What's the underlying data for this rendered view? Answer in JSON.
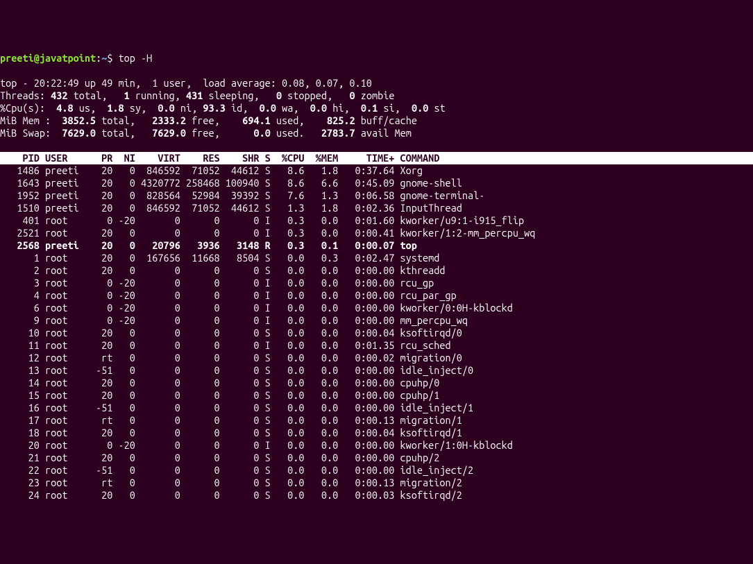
{
  "prompt": {
    "user": "preeti",
    "host": "javatpoint",
    "path": "~",
    "command": "top -H"
  },
  "summary": {
    "line1": "top - 20:22:49 up 49 min,  1 user,  load average: 0.08, 0.07, 0.10",
    "line2_prefix": "Threads: ",
    "line2_total": "432",
    "line2_total_lbl": " total,   ",
    "line2_running": "1",
    "line2_running_lbl": " running, ",
    "line2_sleeping": "431",
    "line2_sleeping_lbl": " sleeping,   ",
    "line2_stopped": "0",
    "line2_stopped_lbl": " stopped,   ",
    "line2_zombie": "0",
    "line2_zombie_lbl": " zombie",
    "line3_prefix": "%Cpu(s):  ",
    "line3_us": "4.8",
    "line3_us_lbl": " us,  ",
    "line3_sy": "1.8",
    "line3_sy_lbl": " sy,  ",
    "line3_ni": "0.0",
    "line3_ni_lbl": " ni, ",
    "line3_id": "93.3",
    "line3_id_lbl": " id,  ",
    "line3_wa": "0.0",
    "line3_wa_lbl": " wa,  ",
    "line3_hi": "0.0",
    "line3_hi_lbl": " hi,  ",
    "line3_si": "0.1",
    "line3_si_lbl": " si,  ",
    "line3_st": "0.0",
    "line3_st_lbl": " st",
    "line4_prefix": "MiB Mem :  ",
    "line4_total": "3852.5",
    "line4_total_lbl": " total,   ",
    "line4_free": "2333.2",
    "line4_free_lbl": " free,    ",
    "line4_used": "694.1",
    "line4_used_lbl": " used,    ",
    "line4_buff": "825.2",
    "line4_buff_lbl": " buff/cache",
    "line5_prefix": "MiB Swap:  ",
    "line5_total": "7629.0",
    "line5_total_lbl": " total,   ",
    "line5_free": "7629.0",
    "line5_free_lbl": " free,      ",
    "line5_used": "0.0",
    "line5_used_lbl": " used.   ",
    "line5_avail": "2783.7",
    "line5_avail_lbl": " avail Mem"
  },
  "header": "    PID USER      PR  NI    VIRT    RES    SHR S  %CPU  %MEM     TIME+ COMMAND                                                          ",
  "processes": [
    {
      "pid": "1486",
      "user": "preeti",
      "pr": "20",
      "ni": "0",
      "virt": "846592",
      "res": "71052",
      "shr": "44612",
      "s": "S",
      "cpu": "8.6",
      "mem": "1.8",
      "time": "0:37.64",
      "cmd": "Xorg",
      "bold": false
    },
    {
      "pid": "1643",
      "user": "preeti",
      "pr": "20",
      "ni": "0",
      "virt": "4320772",
      "res": "258468",
      "shr": "100940",
      "s": "S",
      "cpu": "8.6",
      "mem": "6.6",
      "time": "0:45.09",
      "cmd": "gnome-shell",
      "bold": false
    },
    {
      "pid": "1952",
      "user": "preeti",
      "pr": "20",
      "ni": "0",
      "virt": "828564",
      "res": "52984",
      "shr": "39392",
      "s": "S",
      "cpu": "7.6",
      "mem": "1.3",
      "time": "0:06.58",
      "cmd": "gnome-terminal-",
      "bold": false
    },
    {
      "pid": "1510",
      "user": "preeti",
      "pr": "20",
      "ni": "0",
      "virt": "846592",
      "res": "71052",
      "shr": "44612",
      "s": "S",
      "cpu": "1.3",
      "mem": "1.8",
      "time": "0:02.36",
      "cmd": "InputThread",
      "bold": false
    },
    {
      "pid": "401",
      "user": "root",
      "pr": "0",
      "ni": "-20",
      "virt": "0",
      "res": "0",
      "shr": "0",
      "s": "I",
      "cpu": "0.3",
      "mem": "0.0",
      "time": "0:01.60",
      "cmd": "kworker/u9:1-i915_flip",
      "bold": false
    },
    {
      "pid": "2521",
      "user": "root",
      "pr": "20",
      "ni": "0",
      "virt": "0",
      "res": "0",
      "shr": "0",
      "s": "I",
      "cpu": "0.3",
      "mem": "0.0",
      "time": "0:00.41",
      "cmd": "kworker/1:2-mm_percpu_wq",
      "bold": false
    },
    {
      "pid": "2568",
      "user": "preeti",
      "pr": "20",
      "ni": "0",
      "virt": "20796",
      "res": "3936",
      "shr": "3148",
      "s": "R",
      "cpu": "0.3",
      "mem": "0.1",
      "time": "0:00.07",
      "cmd": "top",
      "bold": true
    },
    {
      "pid": "1",
      "user": "root",
      "pr": "20",
      "ni": "0",
      "virt": "167656",
      "res": "11668",
      "shr": "8504",
      "s": "S",
      "cpu": "0.0",
      "mem": "0.3",
      "time": "0:02.47",
      "cmd": "systemd",
      "bold": false
    },
    {
      "pid": "2",
      "user": "root",
      "pr": "20",
      "ni": "0",
      "virt": "0",
      "res": "0",
      "shr": "0",
      "s": "S",
      "cpu": "0.0",
      "mem": "0.0",
      "time": "0:00.00",
      "cmd": "kthreadd",
      "bold": false
    },
    {
      "pid": "3",
      "user": "root",
      "pr": "0",
      "ni": "-20",
      "virt": "0",
      "res": "0",
      "shr": "0",
      "s": "I",
      "cpu": "0.0",
      "mem": "0.0",
      "time": "0:00.00",
      "cmd": "rcu_gp",
      "bold": false
    },
    {
      "pid": "4",
      "user": "root",
      "pr": "0",
      "ni": "-20",
      "virt": "0",
      "res": "0",
      "shr": "0",
      "s": "I",
      "cpu": "0.0",
      "mem": "0.0",
      "time": "0:00.00",
      "cmd": "rcu_par_gp",
      "bold": false
    },
    {
      "pid": "6",
      "user": "root",
      "pr": "0",
      "ni": "-20",
      "virt": "0",
      "res": "0",
      "shr": "0",
      "s": "I",
      "cpu": "0.0",
      "mem": "0.0",
      "time": "0:00.00",
      "cmd": "kworker/0:0H-kblockd",
      "bold": false
    },
    {
      "pid": "9",
      "user": "root",
      "pr": "0",
      "ni": "-20",
      "virt": "0",
      "res": "0",
      "shr": "0",
      "s": "I",
      "cpu": "0.0",
      "mem": "0.0",
      "time": "0:00.00",
      "cmd": "mm_percpu_wq",
      "bold": false
    },
    {
      "pid": "10",
      "user": "root",
      "pr": "20",
      "ni": "0",
      "virt": "0",
      "res": "0",
      "shr": "0",
      "s": "S",
      "cpu": "0.0",
      "mem": "0.0",
      "time": "0:00.04",
      "cmd": "ksoftirqd/0",
      "bold": false
    },
    {
      "pid": "11",
      "user": "root",
      "pr": "20",
      "ni": "0",
      "virt": "0",
      "res": "0",
      "shr": "0",
      "s": "I",
      "cpu": "0.0",
      "mem": "0.0",
      "time": "0:01.35",
      "cmd": "rcu_sched",
      "bold": false
    },
    {
      "pid": "12",
      "user": "root",
      "pr": "rt",
      "ni": "0",
      "virt": "0",
      "res": "0",
      "shr": "0",
      "s": "S",
      "cpu": "0.0",
      "mem": "0.0",
      "time": "0:00.02",
      "cmd": "migration/0",
      "bold": false
    },
    {
      "pid": "13",
      "user": "root",
      "pr": "-51",
      "ni": "0",
      "virt": "0",
      "res": "0",
      "shr": "0",
      "s": "S",
      "cpu": "0.0",
      "mem": "0.0",
      "time": "0:00.00",
      "cmd": "idle_inject/0",
      "bold": false
    },
    {
      "pid": "14",
      "user": "root",
      "pr": "20",
      "ni": "0",
      "virt": "0",
      "res": "0",
      "shr": "0",
      "s": "S",
      "cpu": "0.0",
      "mem": "0.0",
      "time": "0:00.00",
      "cmd": "cpuhp/0",
      "bold": false
    },
    {
      "pid": "15",
      "user": "root",
      "pr": "20",
      "ni": "0",
      "virt": "0",
      "res": "0",
      "shr": "0",
      "s": "S",
      "cpu": "0.0",
      "mem": "0.0",
      "time": "0:00.00",
      "cmd": "cpuhp/1",
      "bold": false
    },
    {
      "pid": "16",
      "user": "root",
      "pr": "-51",
      "ni": "0",
      "virt": "0",
      "res": "0",
      "shr": "0",
      "s": "S",
      "cpu": "0.0",
      "mem": "0.0",
      "time": "0:00.00",
      "cmd": "idle_inject/1",
      "bold": false
    },
    {
      "pid": "17",
      "user": "root",
      "pr": "rt",
      "ni": "0",
      "virt": "0",
      "res": "0",
      "shr": "0",
      "s": "S",
      "cpu": "0.0",
      "mem": "0.0",
      "time": "0:00.13",
      "cmd": "migration/1",
      "bold": false
    },
    {
      "pid": "18",
      "user": "root",
      "pr": "20",
      "ni": "0",
      "virt": "0",
      "res": "0",
      "shr": "0",
      "s": "S",
      "cpu": "0.0",
      "mem": "0.0",
      "time": "0:00.04",
      "cmd": "ksoftirqd/1",
      "bold": false
    },
    {
      "pid": "20",
      "user": "root",
      "pr": "0",
      "ni": "-20",
      "virt": "0",
      "res": "0",
      "shr": "0",
      "s": "I",
      "cpu": "0.0",
      "mem": "0.0",
      "time": "0:00.00",
      "cmd": "kworker/1:0H-kblockd",
      "bold": false
    },
    {
      "pid": "21",
      "user": "root",
      "pr": "20",
      "ni": "0",
      "virt": "0",
      "res": "0",
      "shr": "0",
      "s": "S",
      "cpu": "0.0",
      "mem": "0.0",
      "time": "0:00.00",
      "cmd": "cpuhp/2",
      "bold": false
    },
    {
      "pid": "22",
      "user": "root",
      "pr": "-51",
      "ni": "0",
      "virt": "0",
      "res": "0",
      "shr": "0",
      "s": "S",
      "cpu": "0.0",
      "mem": "0.0",
      "time": "0:00.00",
      "cmd": "idle_inject/2",
      "bold": false
    },
    {
      "pid": "23",
      "user": "root",
      "pr": "rt",
      "ni": "0",
      "virt": "0",
      "res": "0",
      "shr": "0",
      "s": "S",
      "cpu": "0.0",
      "mem": "0.0",
      "time": "0:00.13",
      "cmd": "migration/2",
      "bold": false
    },
    {
      "pid": "24",
      "user": "root",
      "pr": "20",
      "ni": "0",
      "virt": "0",
      "res": "0",
      "shr": "0",
      "s": "S",
      "cpu": "0.0",
      "mem": "0.0",
      "time": "0:00.03",
      "cmd": "ksoftirqd/2",
      "bold": false
    }
  ]
}
